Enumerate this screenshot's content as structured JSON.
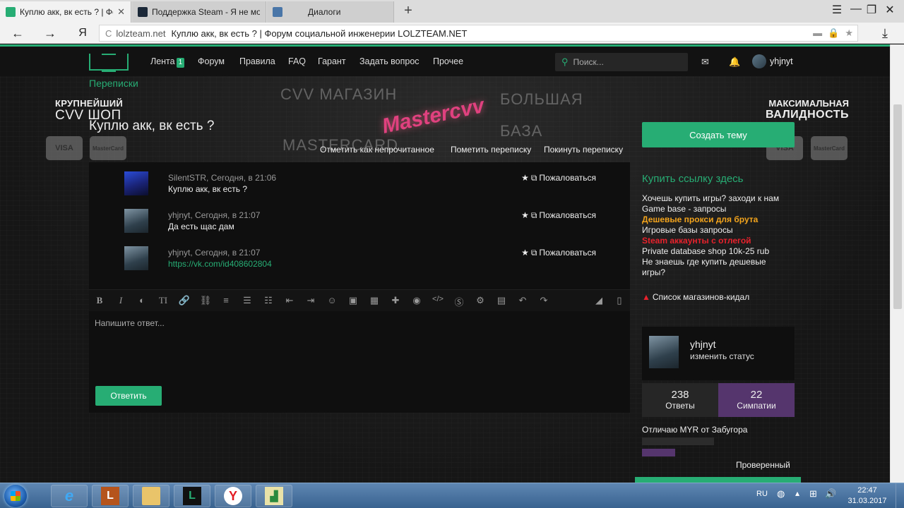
{
  "browser": {
    "tabs": [
      {
        "title": "Куплю акк, вк есть ? | Фо",
        "active": true
      },
      {
        "title": "Поддержка Steam - Я не мо",
        "active": false
      },
      {
        "title": "Диалоги",
        "active": false
      }
    ],
    "address": {
      "domain": "lolzteam.net",
      "title": "Куплю акк, вк есть ? | Форум социальной инженерии LOLZTEAM.NET"
    },
    "yandex_btn": "Я"
  },
  "nav": {
    "items": [
      {
        "label": "Лента",
        "badge": "1"
      },
      {
        "label": "Форум"
      },
      {
        "label": "Правила"
      },
      {
        "label": "FAQ"
      },
      {
        "label": "Гарант"
      },
      {
        "label": "Задать вопрос"
      },
      {
        "label": "Прочее"
      }
    ],
    "search_placeholder": "Поиск...",
    "username": "yhjnyt"
  },
  "breadcrumb": "Переписки",
  "banner": {
    "left_top": "КРУПНЕЙШИЙ",
    "left_bottom": "CVV ШОП",
    "right_top": "МАКСИМАЛЬНАЯ",
    "right_bottom": "ВАЛИДНОСТЬ",
    "card1": "VISA",
    "card2": "MasterCard"
  },
  "page_title": "Куплю акк, вк есть ?",
  "actions": {
    "mark_unread": "Отметить как непрочитанное",
    "mark": "Пометить переписку",
    "leave": "Покинуть переписку"
  },
  "messages": [
    {
      "author": "SilentSTR",
      "time": "Сегодня, в 21:06",
      "text": "Куплю акк, вк есть ?",
      "is_link": false,
      "report": "Пожаловаться"
    },
    {
      "author": "yhjnyt",
      "time": "Сегодня, в 21:07",
      "text": "Да есть щас дам",
      "is_link": false,
      "report": "Пожаловаться"
    },
    {
      "author": "yhjnyt",
      "time": "Сегодня, в 21:07",
      "text": "https://vk.com/id408602804",
      "is_link": true,
      "report": "Пожаловаться"
    }
  ],
  "editor": {
    "placeholder": "Напишите ответ...",
    "reply_button": "Ответить",
    "toolbar_icons": [
      "bold-icon",
      "italic-icon",
      "contrast-icon",
      "text-size-icon",
      "link-icon",
      "unlink-icon",
      "align-icon",
      "bullet-list-icon",
      "numbered-list-icon",
      "outdent-icon",
      "indent-icon",
      "smiley-icon",
      "image-icon",
      "media-icon",
      "plus-icon",
      "hide-icon",
      "code-icon",
      "skype-icon",
      "steam-icon",
      "save-icon",
      "undo-icon",
      "redo-icon",
      "eraser-icon",
      "source-icon"
    ]
  },
  "sidebar": {
    "create_topic": "Создать тему",
    "ad_title": "Купить ссылку здесь",
    "ad_lines": [
      {
        "text": "Хочешь купить игры? заходи к нам",
        "style": "normal"
      },
      {
        "text": "Game base - запросы",
        "style": "normal"
      },
      {
        "text": "Дешевые прокси для брута",
        "style": "orange"
      },
      {
        "text": "Игровые базы запросы",
        "style": "normal"
      },
      {
        "text": "Steam аккаунты с отлегой",
        "style": "red"
      },
      {
        "text": "Private database shop 10k-25 rub",
        "style": "normal"
      },
      {
        "text": "Не знаешь где купить дешевые игры?",
        "style": "wrap"
      }
    ],
    "scam_list": "Список магазинов-кидал",
    "profile": {
      "name": "yhjnyt",
      "status": "изменить статус"
    },
    "stats": {
      "answers_count": "238",
      "answers_label": "Ответы",
      "likes_count": "22",
      "likes_label": "Симпатии"
    },
    "note": "Отличаю MYR от Забугора",
    "verified": "Проверенный"
  },
  "taskbar": {
    "lang": "RU",
    "time": "22:47",
    "date": "31.03.2017"
  },
  "colors": {
    "accent": "#27ad74",
    "purple": "#55356d",
    "orange": "#f3a41c",
    "red": "#e8222c"
  }
}
